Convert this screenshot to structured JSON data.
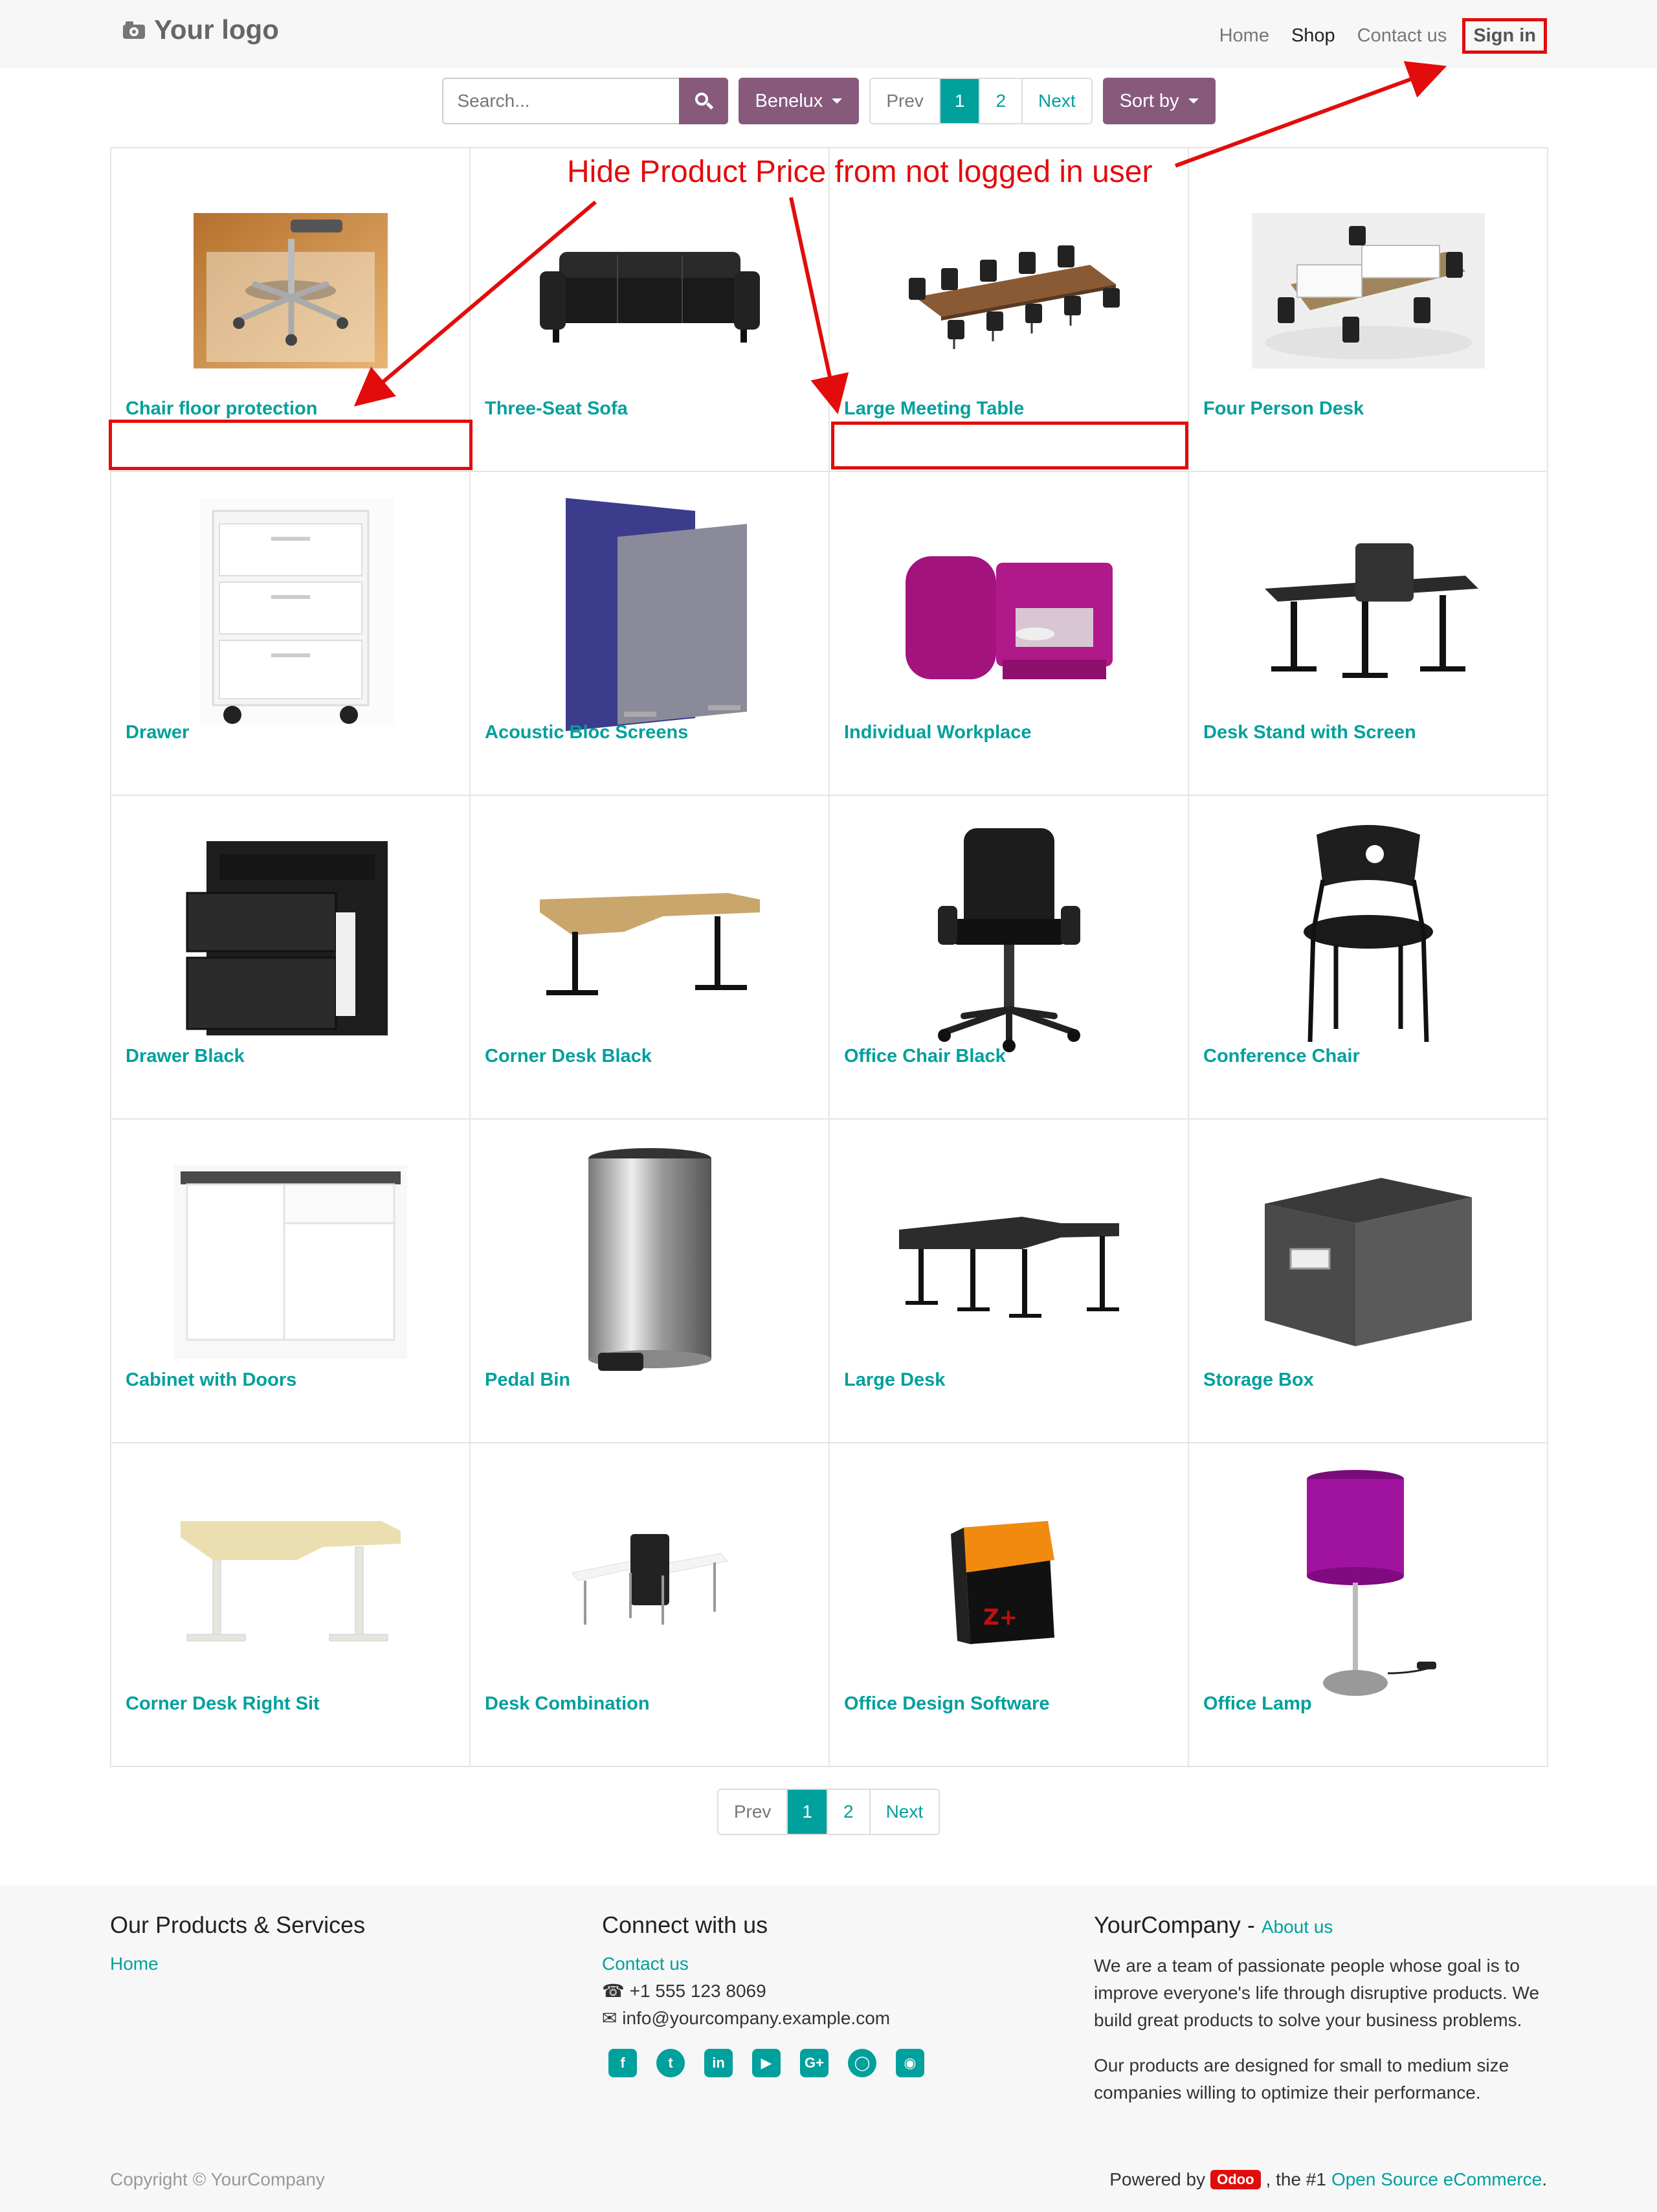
{
  "header": {
    "logo_text": "Your logo",
    "nav": [
      "Home",
      "Shop",
      "Contact us"
    ],
    "sign_in": "Sign in"
  },
  "toolbar": {
    "search_placeholder": "Search...",
    "pricelist": "Benelux",
    "pager": [
      "Prev",
      "1",
      "2",
      "Next"
    ],
    "sort": "Sort by"
  },
  "annotation": {
    "text": "Hide Product Price from not logged in user",
    "color": "#e30c0c"
  },
  "products": [
    {
      "name": "Chair floor protection"
    },
    {
      "name": "Three-Seat Sofa"
    },
    {
      "name": "Large Meeting Table"
    },
    {
      "name": "Four Person Desk"
    },
    {
      "name": "Drawer"
    },
    {
      "name": "Acoustic Bloc Screens"
    },
    {
      "name": "Individual Workplace"
    },
    {
      "name": "Desk Stand with Screen"
    },
    {
      "name": "Drawer Black"
    },
    {
      "name": "Corner Desk Black"
    },
    {
      "name": "Office Chair Black"
    },
    {
      "name": "Conference Chair"
    },
    {
      "name": "Cabinet with Doors"
    },
    {
      "name": "Pedal Bin"
    },
    {
      "name": "Large Desk"
    },
    {
      "name": "Storage Box"
    },
    {
      "name": "Corner Desk Right Sit"
    },
    {
      "name": "Desk Combination"
    },
    {
      "name": "Office Design Software"
    },
    {
      "name": "Office Lamp"
    }
  ],
  "pager_bottom": [
    "Prev",
    "1",
    "2",
    "Next"
  ],
  "footer": {
    "col1": {
      "title": "Our Products & Services",
      "links": [
        "Home"
      ]
    },
    "col2": {
      "title": "Connect with us",
      "contact_link": "Contact us",
      "phone": "+1 555 123 8069",
      "email": "info@yourcompany.example.com",
      "social": [
        "facebook-icon",
        "twitter-icon",
        "linkedin-icon",
        "youtube-icon",
        "google-plus-icon",
        "github-icon",
        "instagram-icon"
      ]
    },
    "col3": {
      "title": "YourCompany",
      "title_sep": "-",
      "about_link": "About us",
      "para1": "We are a team of passionate people whose goal is to improve everyone's life through disruptive products. We build great products to solve your business problems.",
      "para2": "Our products are designed for small to medium size companies willing to optimize their performance."
    },
    "copyright": "Copyright © YourCompany",
    "powered_prefix": "Powered by",
    "powered_badge": "Odoo",
    "powered_mid": ", the #1",
    "powered_link": "Open Source eCommerce",
    "powered_suffix": "."
  },
  "colors": {
    "accent": "#00a09d",
    "primary": "#875a7b",
    "annotation": "#e30c0c"
  }
}
